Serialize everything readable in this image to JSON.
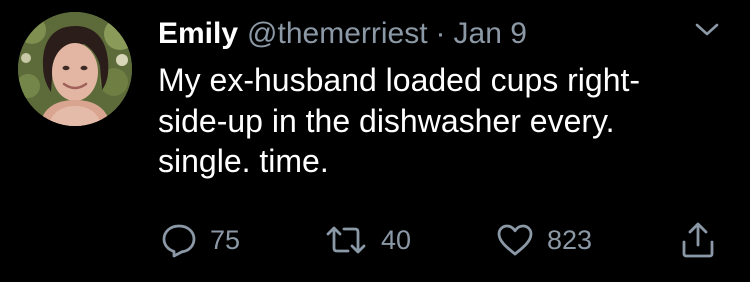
{
  "tweet": {
    "author": {
      "display_name": "Emily",
      "handle": "@themerriest"
    },
    "separator": "·",
    "date": "Jan 9",
    "text_lines": [
      "My ex-husband loaded cups right-",
      "side-up in the dishwasher every.",
      "single. time."
    ],
    "actions": {
      "reply": {
        "icon": "reply-icon",
        "count": "75"
      },
      "retweet": {
        "icon": "retweet-icon",
        "count": "40"
      },
      "like": {
        "icon": "heart-icon",
        "count": "823"
      },
      "share": {
        "icon": "share-icon"
      }
    }
  },
  "colors": {
    "background": "#000000",
    "primary_text": "#ffffff",
    "secondary_text": "#8b98a5"
  }
}
